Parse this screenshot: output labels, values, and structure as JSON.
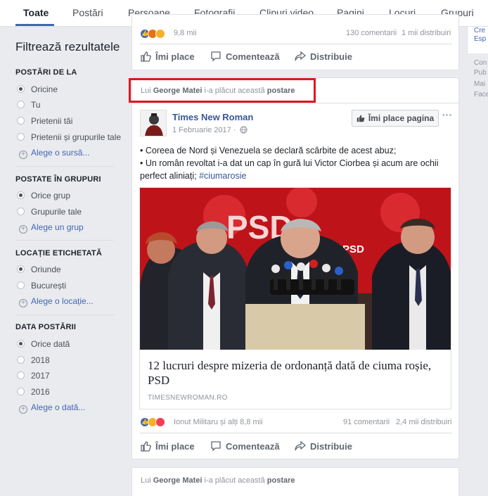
{
  "tabs": [
    "Toate",
    "Postări",
    "Persoane",
    "Fotografii",
    "Clipuri video",
    "Pagini",
    "Locuri",
    "Grupuri"
  ],
  "sidebar": {
    "title": "Filtrează rezultatele",
    "sections": [
      {
        "title": "POSTĂRI DE LA",
        "options": [
          "Oricine",
          "Tu",
          "Prietenii tăi",
          "Prietenii și grupurile tale"
        ],
        "selected": 0,
        "add": "Alege o sursă..."
      },
      {
        "title": "POSTATE ÎN GRUPURI",
        "options": [
          "Orice grup",
          "Grupurile tale"
        ],
        "selected": 0,
        "add": "Alege un grup"
      },
      {
        "title": "LOCAȚIE ETICHETATĂ",
        "options": [
          "Oriunde",
          "București"
        ],
        "selected": 0,
        "add": "Alege o locație..."
      },
      {
        "title": "DATA POSTĂRII",
        "options": [
          "Orice dată",
          "2018",
          "2017",
          "2016"
        ],
        "selected": 0,
        "add": "Alege o dată..."
      }
    ]
  },
  "top_card": {
    "reaction_count": "9,8 mii",
    "comments": "130 comentarii",
    "shares": "1 mii distribuiri"
  },
  "actions": {
    "like": "Îmi place",
    "comment": "Comentează",
    "share": "Distribuie"
  },
  "story": {
    "liker_prefix": "Lui",
    "liker_name": "George Matei",
    "liker_suffix": "i-a plăcut această",
    "liker_obj": "postare",
    "page_name": "Times New Roman",
    "date": "1 Februarie 2017 ·",
    "like_page": "Îmi place pagina",
    "more": "···",
    "line1": "• Coreea de Nord și Venezuela se declară scârbite de acest abuz;",
    "line2": "• Un român revoltat i-a dat un cap în gură lui Victor Ciorbea și acum are ochii perfect aliniați;",
    "hashtag": "#ciumarosie",
    "sign_text": "PSD",
    "link_title": "12 lucruri despre mizeria de ordonanță dată de ciuma roșie, PSD",
    "link_domain": "TIMESNEWROMAN.RO",
    "reactors": "Ionut Militaru și alți 8,8 mii",
    "comments": "91 comentarii",
    "shares": "2,4 mii distribuiri"
  },
  "bottom_card": {
    "liker_prefix": "Lui",
    "liker_name": "George Matei",
    "liker_suffix": "i-a plăcut această",
    "liker_obj": "postare"
  },
  "right_col": {
    "items": [
      "Cre",
      "Esp",
      "Con",
      "Pub",
      "Mai",
      "Face"
    ]
  },
  "colors": {
    "accent": "#4267b2",
    "highlight": "#e0181e",
    "photo_red": "#c8141c"
  }
}
